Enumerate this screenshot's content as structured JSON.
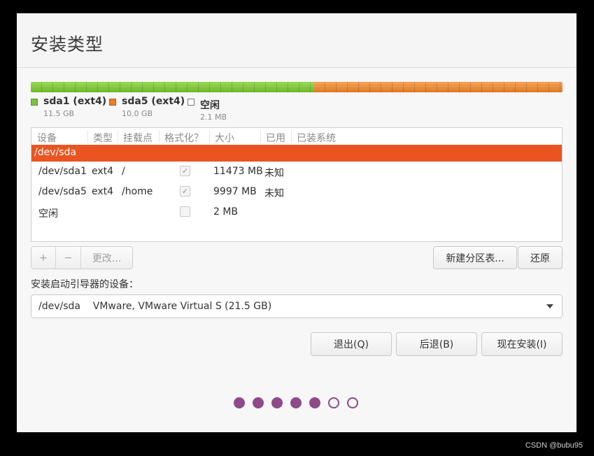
{
  "title": "安装类型",
  "partition_bar": {
    "segments": [
      {
        "name": "sda1 (ext4)",
        "size": "11.5 GB",
        "color": "#7cc242"
      },
      {
        "name": "sda5 (ext4)",
        "size": "10.0 GB",
        "color": "#e97f26"
      },
      {
        "name": "空闲",
        "size": "2.1 MB",
        "color": "#ffffff"
      }
    ]
  },
  "table": {
    "headers": [
      "设备",
      "类型",
      "挂载点",
      "格式化？",
      "大小",
      "已用",
      "已装系统"
    ],
    "disk_row": "/dev/sda",
    "rows": [
      {
        "device": "/dev/sda1",
        "type": "ext4",
        "mount": "/",
        "format": true,
        "size": "11473 MB",
        "used": "未知"
      },
      {
        "device": "/dev/sda5",
        "type": "ext4",
        "mount": "/home",
        "format": true,
        "size": "9997 MB",
        "used": "未知"
      },
      {
        "device": "空闲",
        "type": "",
        "mount": "",
        "format": false,
        "size": "2 MB",
        "used": ""
      }
    ]
  },
  "toolbar": {
    "add": "+",
    "remove": "−",
    "change": "更改...",
    "new_table": "新建分区表...",
    "revert": "还原"
  },
  "bootloader": {
    "label": "安装启动引导器的设备：",
    "value": "/dev/sda    VMware, VMware Virtual S (21.5 GB)"
  },
  "actions": {
    "quit": "退出(Q)",
    "back": "后退(B)",
    "install": "现在安装(I)"
  },
  "progress": {
    "total": 7,
    "completed": 5
  },
  "watermark": "CSDN @bubu95",
  "colors": {
    "accent": "#e95420",
    "progress_dot": "#8e4a89"
  }
}
